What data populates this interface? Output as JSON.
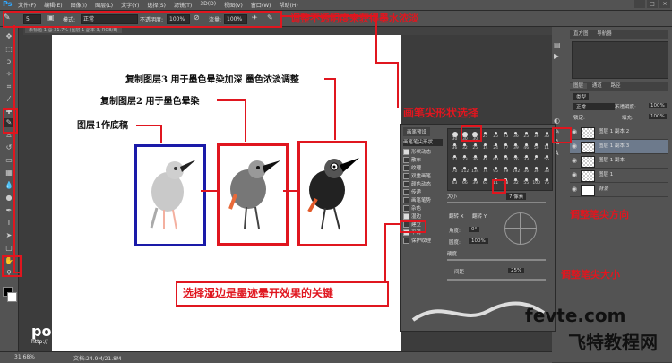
{
  "app": {
    "logo": "Ps",
    "menu": [
      "文件(F)",
      "编辑(E)",
      "图像(I)",
      "图层(L)",
      "文字(Y)",
      "选择(S)",
      "滤镜(T)",
      "3D(D)",
      "视图(V)",
      "窗口(W)",
      "帮助(H)"
    ],
    "window_controls": [
      "–",
      "□",
      "×"
    ]
  },
  "options": {
    "brush_size": "5",
    "mode_label": "模式:",
    "mode_value": "正常",
    "opacity_label": "不透明度:",
    "opacity_value": "100%",
    "flow_label": "流量:",
    "flow_value": "100%"
  },
  "document": {
    "tab": "未标题-1 @ 31.7% (图层 1 副本 3, RGB/8)"
  },
  "status": {
    "zoom": "31.68%",
    "info": "文档:24.9M/21.8M"
  },
  "canvas_labels": {
    "layer3": "复制图层3 用于墨色晕染加深 墨色浓淡调整",
    "layer2": "复制图层2 用于墨色晕染",
    "layer1": "图层1作底稿"
  },
  "annotations": {
    "top": "调整不透明度来获得墨水浓淡",
    "brush_shape": "画笔尖形状选择",
    "tip_direction": "调整笔尖方向",
    "wet_edges": "选择湿边是墨迹晕开效果的关键",
    "tip_size": "调整笔尖大小"
  },
  "watermark": {
    "left": "poco",
    "left_sub": "http://",
    "site": "fevte.com",
    "site_cn": "飞特教程网"
  },
  "panels": {
    "top_tabs": [
      "直方图",
      "导航器"
    ],
    "layer_tabs": [
      "图层",
      "通道",
      "路径"
    ],
    "kind_label": "类型",
    "blend_mode": "正常",
    "opacity_label": "不透明度:",
    "opacity_value": "100%",
    "lock_label": "锁定:",
    "fill_label": "填充:",
    "fill_value": "100%",
    "layers": [
      "图层 1 副本 2",
      "图层 1 副本 3",
      "图层 1 副本",
      "图层 1",
      "背景"
    ]
  },
  "brush_panel": {
    "tabs": [
      "画笔预设"
    ],
    "header": "画笔笔尖形状",
    "items": [
      {
        "label": "形状动态",
        "checked": true
      },
      {
        "label": "散布",
        "checked": false
      },
      {
        "label": "纹理",
        "checked": false
      },
      {
        "label": "双重画笔",
        "checked": false
      },
      {
        "label": "颜色动态",
        "checked": false
      },
      {
        "label": "传递",
        "checked": false
      },
      {
        "label": "画笔笔势",
        "checked": false
      },
      {
        "label": "杂色",
        "checked": false
      },
      {
        "label": "湿边",
        "checked": true
      },
      {
        "label": "建立",
        "checked": false
      },
      {
        "label": "平滑",
        "checked": true
      },
      {
        "label": "保护纹理",
        "checked": false
      }
    ],
    "tip_sizes": [
      "30",
      "30",
      "30",
      "25",
      "25",
      "25",
      "36",
      "25",
      "36",
      "36",
      "36",
      "32",
      "25",
      "14",
      "24",
      "27",
      "39",
      "46",
      "59",
      "11",
      "17",
      "23",
      "36",
      "44",
      "60",
      "14",
      "26",
      "33",
      "42",
      "55",
      "70",
      "112",
      "134",
      "74",
      "95",
      "29",
      "192",
      "36",
      "36",
      "33",
      "63",
      "66",
      "39",
      "63",
      "11",
      "48",
      "32",
      "55",
      "100",
      "75"
    ],
    "size_label": "大小",
    "size_value": "7 像素",
    "flip_x": "翻转 X",
    "flip_y": "翻转 Y",
    "angle_label": "角度:",
    "angle_value": "0°",
    "roundness_label": "圆度:",
    "roundness_value": "100%",
    "hardness_label": "硬度",
    "spacing_label": "间距",
    "spacing_value": "25%"
  },
  "colors": {
    "accent_red": "#e0161f",
    "frame_blue": "#1a1aa8",
    "ui_gray": "#535353"
  }
}
